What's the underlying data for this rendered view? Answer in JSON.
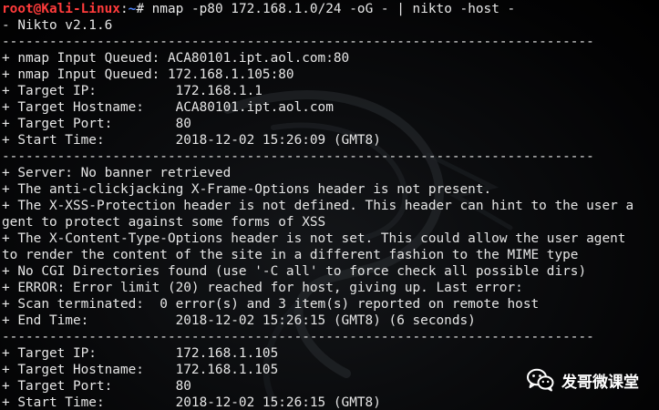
{
  "prompt": {
    "user_host": "root@Kali-Linux",
    "separator": ":",
    "path": "~",
    "symbol": "#",
    "command": " nmap -p80 172.168.1.0/24 -oG - | nikto -host -"
  },
  "output_lines": [
    "- Nikto v2.1.6",
    "---------------------------------------------------------------------------",
    "+ nmap Input Queued: ACA80101.ipt.aol.com:80",
    "+ nmap Input Queued: 172.168.1.105:80",
    "+ Target IP:          172.168.1.1",
    "+ Target Hostname:    ACA80101.ipt.aol.com",
    "+ Target Port:        80",
    "+ Start Time:         2018-12-02 15:26:09 (GMT8)",
    "---------------------------------------------------------------------------",
    "+ Server: No banner retrieved",
    "+ The anti-clickjacking X-Frame-Options header is not present.",
    "+ The X-XSS-Protection header is not defined. This header can hint to the user a",
    "gent to protect against some forms of XSS",
    "+ The X-Content-Type-Options header is not set. This could allow the user agent",
    "to render the content of the site in a different fashion to the MIME type",
    "+ No CGI Directories found (use '-C all' to force check all possible dirs)",
    "+ ERROR: Error limit (20) reached for host, giving up. Last error:",
    "+ Scan terminated:  0 error(s) and 3 item(s) reported on remote host",
    "+ End Time:           2018-12-02 15:26:15 (GMT8) (6 seconds)",
    "---------------------------------------------------------------------------",
    "+ Target IP:          172.168.1.105",
    "+ Target Hostname:    172.168.1.105",
    "+ Target Port:        80",
    "+ Start Time:         2018-12-02 15:26:15 (GMT8)"
  ],
  "watermark": {
    "text": "发哥微课堂",
    "icon": "wechat-icon"
  },
  "colors": {
    "background": "#000000",
    "text": "#e6e6e6",
    "prompt_user": "#ff3b3b",
    "prompt_path": "#4f86ff"
  }
}
